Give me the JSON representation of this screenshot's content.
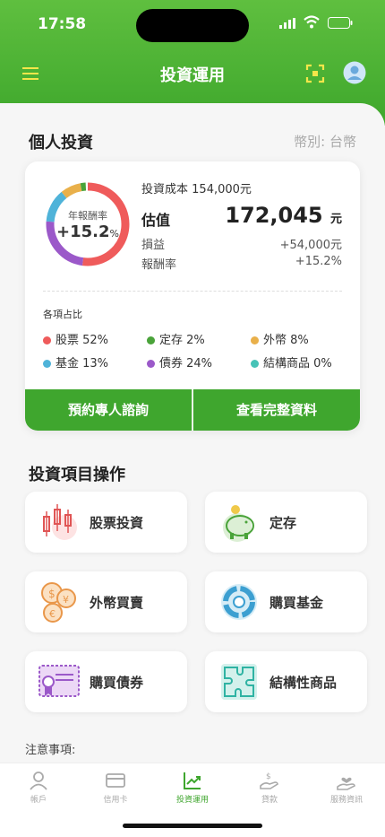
{
  "status": {
    "time": "17:58"
  },
  "nav": {
    "title": "投資運用"
  },
  "personal": {
    "title": "個人投資",
    "currency": "幣別: 台幣",
    "return_label": "年報酬率",
    "return_value": "+15.2",
    "return_unit": "%",
    "cost_label": "投資成本",
    "cost_value": "154,000元",
    "valuation_label": "估值",
    "valuation_value": "172,045",
    "valuation_unit": "元",
    "pnl_label": "損益",
    "pnl_value": "+54,000元",
    "rate_label": "報酬率",
    "rate_value": "+15.2%",
    "alloc_title": "各項占比",
    "allocation": [
      {
        "name": "股票",
        "percent": 52,
        "label": "股票 52%",
        "color": "#ef5b5b"
      },
      {
        "name": "定存",
        "percent": 2,
        "label": "定存 2%",
        "color": "#4aa33a"
      },
      {
        "name": "外幣",
        "percent": 8,
        "label": "外幣 8%",
        "color": "#e9b04a"
      },
      {
        "name": "基金",
        "percent": 13,
        "label": "基金 13%",
        "color": "#4fb3d9"
      },
      {
        "name": "債券",
        "percent": 24,
        "label": "債券 24%",
        "color": "#9b59c9"
      },
      {
        "name": "結構商品",
        "percent": 0,
        "label": "結構商品 0%",
        "color": "#46c3b7"
      }
    ],
    "btn_consult": "預約專人諮詢",
    "btn_details": "查看完整資料"
  },
  "operations": {
    "title": "投資項目操作",
    "items": [
      {
        "label": "股票投資",
        "icon": "candlestick-icon"
      },
      {
        "label": "定存",
        "icon": "piggy-bank-icon"
      },
      {
        "label": "外幣買賣",
        "icon": "currency-coins-icon"
      },
      {
        "label": "購買基金",
        "icon": "pie-chart-icon"
      },
      {
        "label": "購買債券",
        "icon": "certificate-icon"
      },
      {
        "label": "結構性商品",
        "icon": "puzzle-icon"
      }
    ]
  },
  "notes": {
    "title": "注意事項:"
  },
  "tabs": [
    {
      "label": "帳戶",
      "icon": "user-icon"
    },
    {
      "label": "信用卡",
      "icon": "credit-card-icon"
    },
    {
      "label": "投資運用",
      "icon": "chart-icon",
      "active": true
    },
    {
      "label": "貸款",
      "icon": "loan-icon"
    },
    {
      "label": "服務資訊",
      "icon": "service-icon"
    }
  ],
  "colors": {
    "brand_green": "#3fa62e",
    "header_green": "#5fbf3f"
  }
}
